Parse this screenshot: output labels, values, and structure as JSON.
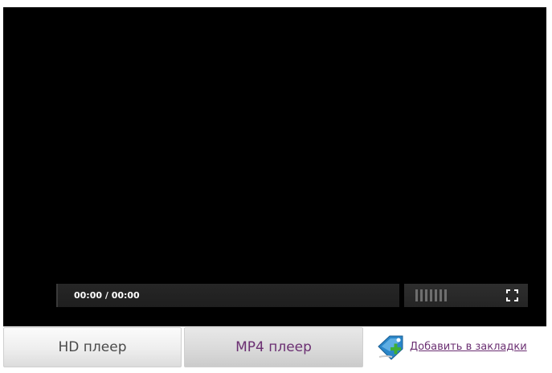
{
  "player": {
    "time_display": "00:00 / 00:00",
    "volume_bars": 7,
    "fullscreen_icon": "fullscreen-icon"
  },
  "buttons": {
    "hd_label": "HD плеер",
    "mp4_label": "MP4 плеер"
  },
  "bookmark": {
    "icon": "bookmark-add-icon",
    "label": "Добавить в закладки"
  },
  "colors": {
    "video_background": "#000000",
    "link": "#6b2f72",
    "button_text": "#4a4a4a"
  }
}
